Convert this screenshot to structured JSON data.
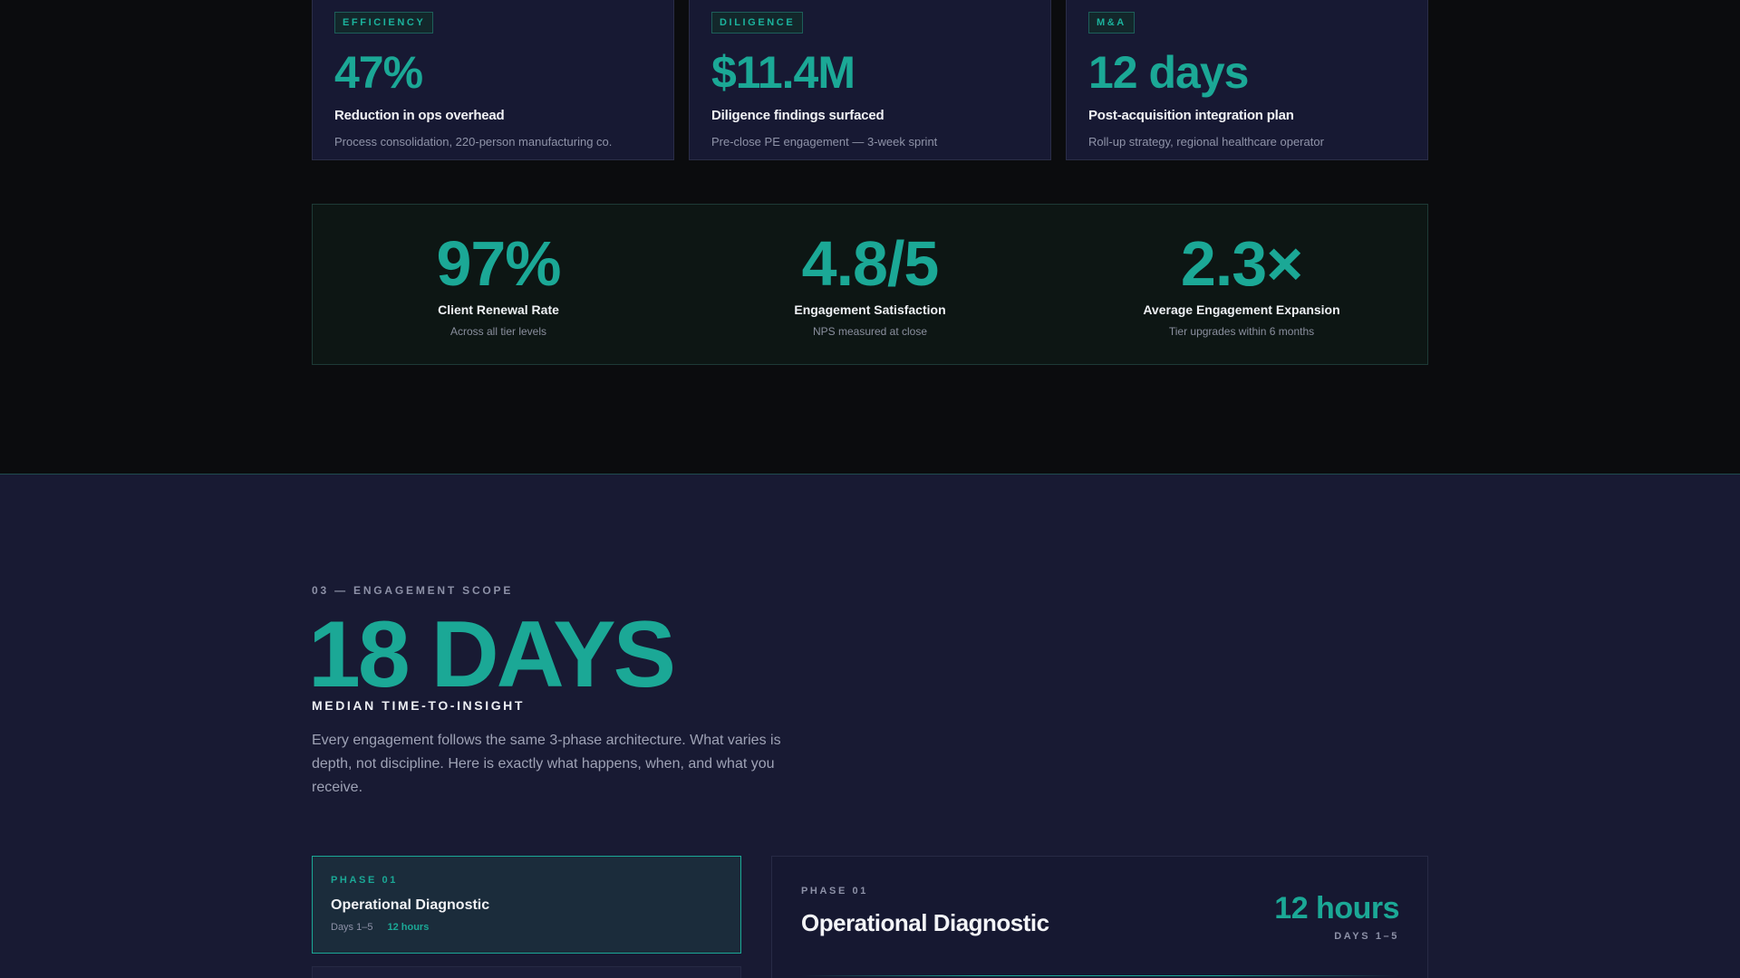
{
  "case_studies": [
    {
      "tag": "EFFICIENCY",
      "value": "47%",
      "title": "Reduction in ops overhead",
      "desc": "Process consolidation, 220-person manufacturing co."
    },
    {
      "tag": "DILIGENCE",
      "value": "$11.4M",
      "title": "Diligence findings surfaced",
      "desc": "Pre-close PE engagement — 3-week sprint"
    },
    {
      "tag": "M&A",
      "value": "12 days",
      "title": "Post-acquisition integration plan",
      "desc": "Roll-up strategy, regional healthcare operator"
    }
  ],
  "stats": [
    {
      "value": "97%",
      "title": "Client Renewal Rate",
      "sub": "Across all tier levels"
    },
    {
      "value": "4.8/5",
      "title": "Engagement Satisfaction",
      "sub": "NPS measured at close"
    },
    {
      "value": "2.3×",
      "title": "Average Engagement Expansion",
      "sub": "Tier upgrades within 6 months"
    }
  ],
  "scope": {
    "eyebrow": "03 — ENGAGEMENT SCOPE",
    "hero_value": "18 DAYS",
    "hero_subtitle": "MEDIAN TIME-TO-INSIGHT",
    "paragraph": "Every engagement follows the same 3-phase architecture. What varies is depth, not discipline. Here is exactly what happens, when, and what you receive."
  },
  "phases": [
    {
      "label": "PHASE 01",
      "name": "Operational Diagnostic",
      "days": "Days 1–5",
      "hours": "12 hours"
    }
  ],
  "detail": {
    "label": "PHASE 01",
    "title": "Operational Diagnostic",
    "hours": "12 hours",
    "days": "DAYS 1–5"
  },
  "colors": {
    "accent": "#1ba896",
    "navy": "#181a33",
    "dark": "#0b0c0e"
  }
}
